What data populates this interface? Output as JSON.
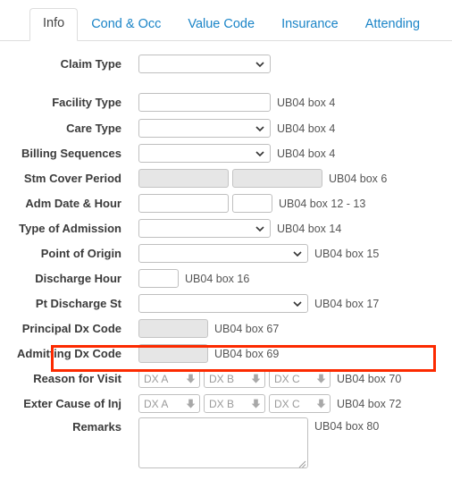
{
  "tabs": [
    {
      "label": "Info",
      "active": true
    },
    {
      "label": "Cond & Occ",
      "active": false
    },
    {
      "label": "Value Code",
      "active": false
    },
    {
      "label": "Insurance",
      "active": false
    },
    {
      "label": "Attending",
      "active": false
    }
  ],
  "dx_placeholders": {
    "a": "DX A",
    "b": "DX B",
    "c": "DX C"
  },
  "rows": {
    "claim_type": {
      "label": "Claim Type",
      "value": "",
      "annotation": ""
    },
    "facility_type": {
      "label": "Facility Type",
      "value": "",
      "annotation": "UB04 box 4"
    },
    "care_type": {
      "label": "Care Type",
      "value": "",
      "annotation": "UB04 box 4"
    },
    "billing_sequences": {
      "label": "Billing Sequences",
      "value": "",
      "annotation": "UB04 box 4"
    },
    "stm_cover_period": {
      "label": "Stm Cover Period",
      "value": "",
      "value2": "",
      "annotation": "UB04 box 6"
    },
    "adm_date_hour": {
      "label": "Adm Date & Hour",
      "value": "",
      "value2": "",
      "annotation": "UB04 box 12 - 13"
    },
    "type_of_admission": {
      "label": "Type of Admission",
      "value": "",
      "annotation": "UB04 box 14"
    },
    "point_of_origin": {
      "label": "Point of Origin",
      "value": "",
      "annotation": "UB04 box 15"
    },
    "discharge_hour": {
      "label": "Discharge Hour",
      "value": "",
      "annotation": "UB04 box 16"
    },
    "pt_discharge_st": {
      "label": "Pt Discharge St",
      "value": "",
      "annotation": "UB04 box 17"
    },
    "principal_dx_code": {
      "label": "Principal Dx Code",
      "value": "",
      "annotation": "UB04 box 67"
    },
    "admitting_dx_code": {
      "label": "Admitting Dx Code",
      "value": "",
      "annotation": "UB04 box 69"
    },
    "reason_for_visit": {
      "label": "Reason for Visit",
      "annotation": "UB04 box 70",
      "highlighted": true
    },
    "exter_cause_of_inj": {
      "label": "Exter Cause of Inj",
      "annotation": "UB04 box 72"
    },
    "remarks": {
      "label": "Remarks",
      "value": "",
      "annotation": "UB04 box 80"
    }
  },
  "colors": {
    "highlight": "#fc2a00",
    "tab_link": "#1a84c7",
    "label": "#3b3b3b",
    "annotation": "#555555",
    "field_border": "#bfbfbf",
    "disabled_bg": "#e6e6e6"
  }
}
